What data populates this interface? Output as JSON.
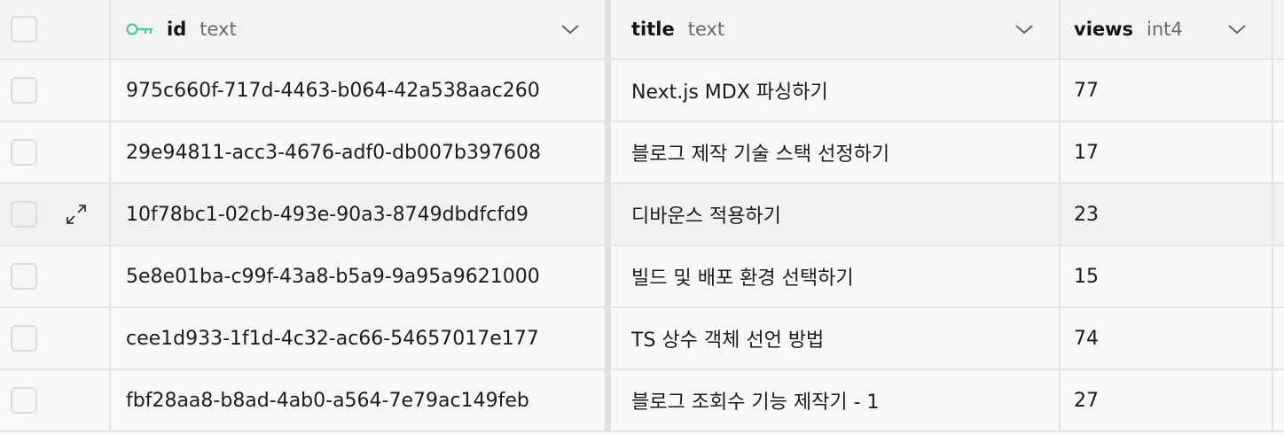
{
  "columns": [
    {
      "name": "id",
      "type": "text",
      "is_primary_key": true
    },
    {
      "name": "title",
      "type": "text"
    },
    {
      "name": "views",
      "type": "int4"
    }
  ],
  "rows": [
    {
      "id": "975c660f-717d-4463-b064-42a538aac260",
      "title": "Next.js MDX 파싱하기",
      "views": "77"
    },
    {
      "id": "29e94811-acc3-4676-adf0-db007b397608",
      "title": "블로그 제작 기술 스택 선정하기",
      "views": "17"
    },
    {
      "id": "10f78bc1-02cb-493e-90a3-8749dbdfcfd9",
      "title": "디바운스 적용하기",
      "views": "23"
    },
    {
      "id": "5e8e01ba-c99f-43a8-b5a9-9a95a9621000",
      "title": "빌드 및 배포 환경 선택하기",
      "views": "15"
    },
    {
      "id": "cee1d933-1f1d-4c32-ac66-54657017e177",
      "title": "TS 상수 객체 선언 방법",
      "views": "74"
    },
    {
      "id": "fbf28aa8-b8ad-4ab0-a564-7e79ac149feb",
      "title": "블로그 조회수 기능 제작기 - 1",
      "views": "27"
    }
  ],
  "hovered_row_index": 2,
  "icons": {
    "primary_key": "key-icon",
    "column_menu": "chevron-down-icon",
    "row_expand": "expand-icon"
  },
  "colors": {
    "key_icon": "#3ecf8e",
    "background": "#f8f8f8",
    "hover_row": "#f1f1f1"
  }
}
